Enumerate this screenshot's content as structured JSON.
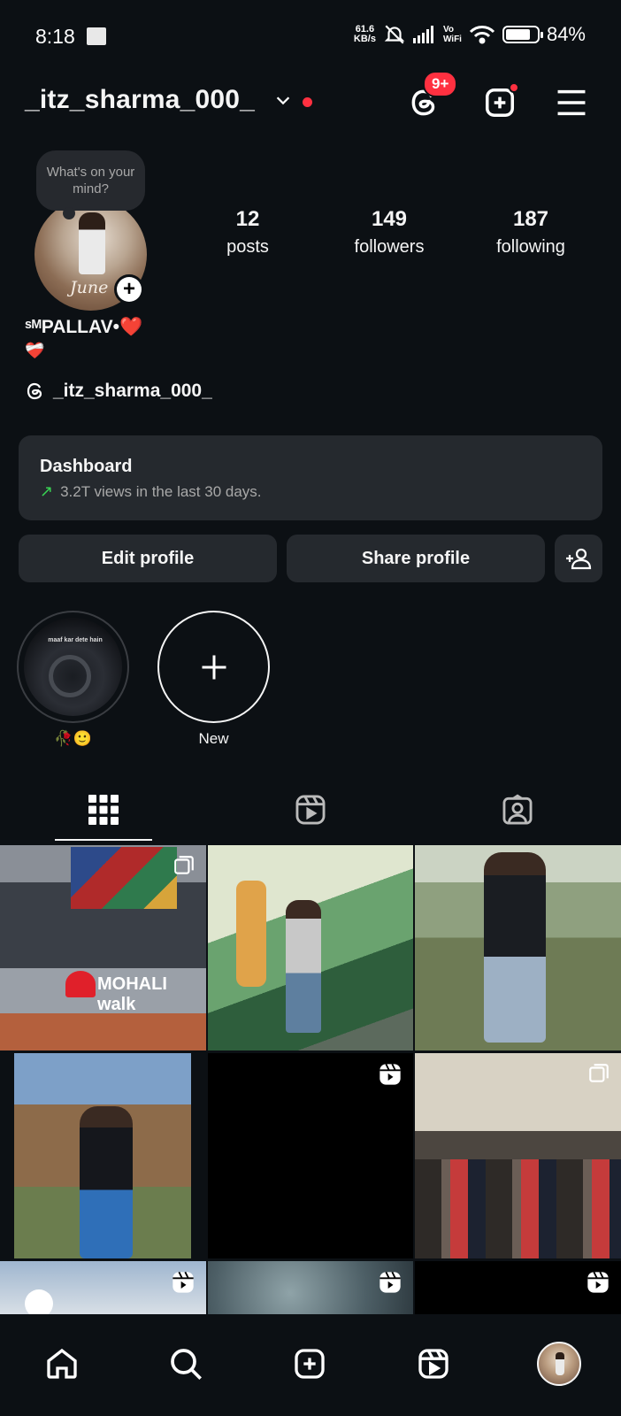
{
  "status_bar": {
    "time": "8:18",
    "net_speed_value": "61.6",
    "net_speed_unit": "KB/s",
    "vowifi_top": "Vo",
    "vowifi_bottom": "WiFi",
    "battery": "84%"
  },
  "header": {
    "username": "_itz_sharma_000_",
    "threads_badge": "9+"
  },
  "profile": {
    "note": "What's on your mind?",
    "avatar_signature": "June",
    "stats": [
      {
        "value": "12",
        "label": "posts"
      },
      {
        "value": "149",
        "label": "followers"
      },
      {
        "value": "187",
        "label": "following"
      }
    ],
    "display_name": "ˢᴹPALLAV•❤️",
    "bio_line2": "❤️‍🩹",
    "threads_handle": "_itz_sharma_000_"
  },
  "dashboard": {
    "title": "Dashboard",
    "subtitle": "3.2T views in the last 30 days."
  },
  "buttons": {
    "edit": "Edit profile",
    "share": "Share profile"
  },
  "highlights": [
    {
      "label": "🥀🙂",
      "cover_text": "maaf kar dete hain"
    },
    {
      "label": "New"
    }
  ],
  "tabs": [
    "posts-grid",
    "reels",
    "tagged"
  ],
  "grid_tiles": [
    {
      "kind": "carousel",
      "text": "MOHALI walk"
    },
    {
      "kind": "photo"
    },
    {
      "kind": "photo"
    },
    {
      "kind": "photo"
    },
    {
      "kind": "reel"
    },
    {
      "kind": "carousel"
    },
    {
      "kind": "reel"
    },
    {
      "kind": "reel"
    },
    {
      "kind": "reel"
    }
  ],
  "bottom_nav": [
    "home",
    "search",
    "create",
    "reels",
    "profile"
  ]
}
